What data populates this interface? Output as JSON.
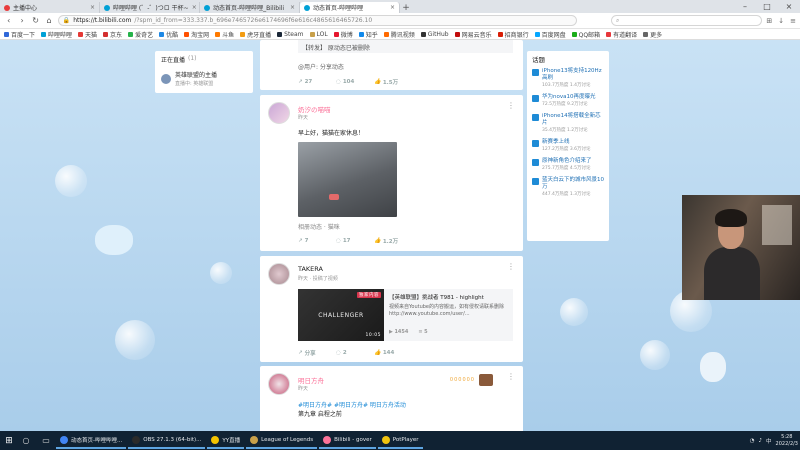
{
  "browser": {
    "tabs": [
      {
        "label": "主播中心",
        "color": "#e93b3b",
        "active": false
      },
      {
        "label": "哔哩哔哩 (゜-゜)つロ 干杯~",
        "color": "#00a1d6",
        "active": false
      },
      {
        "label": "动态首页-哔哩哔哩_Bilibili",
        "color": "#00a1d6",
        "active": false
      },
      {
        "label": "动态首页-哔哩哔哩",
        "color": "#00a1d6",
        "active": true
      }
    ],
    "url": "https://t.bilibili.com",
    "url_rest": "/?spm_id_from=333.337.b_696e7465726e6174696f6e616c4865616465726.10",
    "bookmarks": [
      "百度一下",
      "哔哩哔哩",
      "天猫",
      "京东",
      "爱奇艺",
      "优酷",
      "淘宝网",
      "斗鱼",
      "虎牙直播",
      "Steam",
      "LOL",
      "微博",
      "知乎",
      "腾讯视频",
      "GitHub",
      "网易云音乐",
      "招商银行",
      "百度网盘",
      "QQ邮箱",
      "有道翻译",
      "更多"
    ]
  },
  "live_card": {
    "title": "正在直播",
    "count": "(1)",
    "streamer": "英雄联盟的主播",
    "subtitle": "直播中: 英雄联盟"
  },
  "feed1": {
    "quote": "【转发】 原动态已被删除",
    "sub": "@用户: 分享动态",
    "actions": [
      "27",
      "104",
      "1.5万"
    ]
  },
  "feed2": {
    "name": "奶汐の喵喵",
    "time": "昨天",
    "text": "早上好，猫猫在家休息！",
    "tag": "相册动态 · 猫咪",
    "actions": [
      "7",
      "17",
      "1.2万"
    ]
  },
  "feed3": {
    "name": "TAKERA",
    "time": "昨天 · 投稿了视频",
    "video_title": "【英雄联盟】挑战者 T981 - highlight",
    "video_desc": "视频来自Youtube的内容搬运，如有侵权请联系删除 http://www.youtube.com/user/...",
    "thumb_text": "CHALLENGER",
    "badge": "独家内容",
    "duration": "10:05",
    "plays": "1454",
    "comments": "5",
    "actions": [
      "分享",
      "2",
      "144"
    ]
  },
  "feed4": {
    "name": "明日方舟",
    "time": "昨天",
    "text": "#明日方舟# #明日方舟# 明日方舟活动",
    "sub": "第九章 启程之前",
    "deco_num": "000000"
  },
  "trend": {
    "title": "话题",
    "items": [
      {
        "t": "iPhone13将支持120Hz高刷",
        "n": "103.7万热度 1.4万讨论"
      },
      {
        "t": "华为nova10再度曝光",
        "n": "72.5万热度 9.2万讨论"
      },
      {
        "t": "iPhone14将搭载全新芯片",
        "n": "35.4万热度 1.2万讨论"
      },
      {
        "t": "新赛季上线",
        "n": "127.2万热度 3.6万讨论"
      },
      {
        "t": "原神新角色介绍来了",
        "n": "275.7万热度 4.5万讨论"
      },
      {
        "t": "蓝天白云下的城市风景10万",
        "n": "447.4万热度 1.3万讨论"
      }
    ]
  },
  "taskbar": {
    "tasks": [
      {
        "label": "动态首页-哔哩哔哩...",
        "color": "#4285f4"
      },
      {
        "label": "OBS 27.1.3 (64-bit)...",
        "color": "#2b2b2b"
      },
      {
        "label": "YY直播",
        "color": "#f5c400"
      },
      {
        "label": "League of Legends",
        "color": "#c8a04a"
      },
      {
        "label": "Bilibili - gover",
        "color": "#fb7299"
      },
      {
        "label": "PotPlayer",
        "color": "#f1c40f"
      }
    ],
    "time": "5:28",
    "date": "2022/2/3"
  }
}
